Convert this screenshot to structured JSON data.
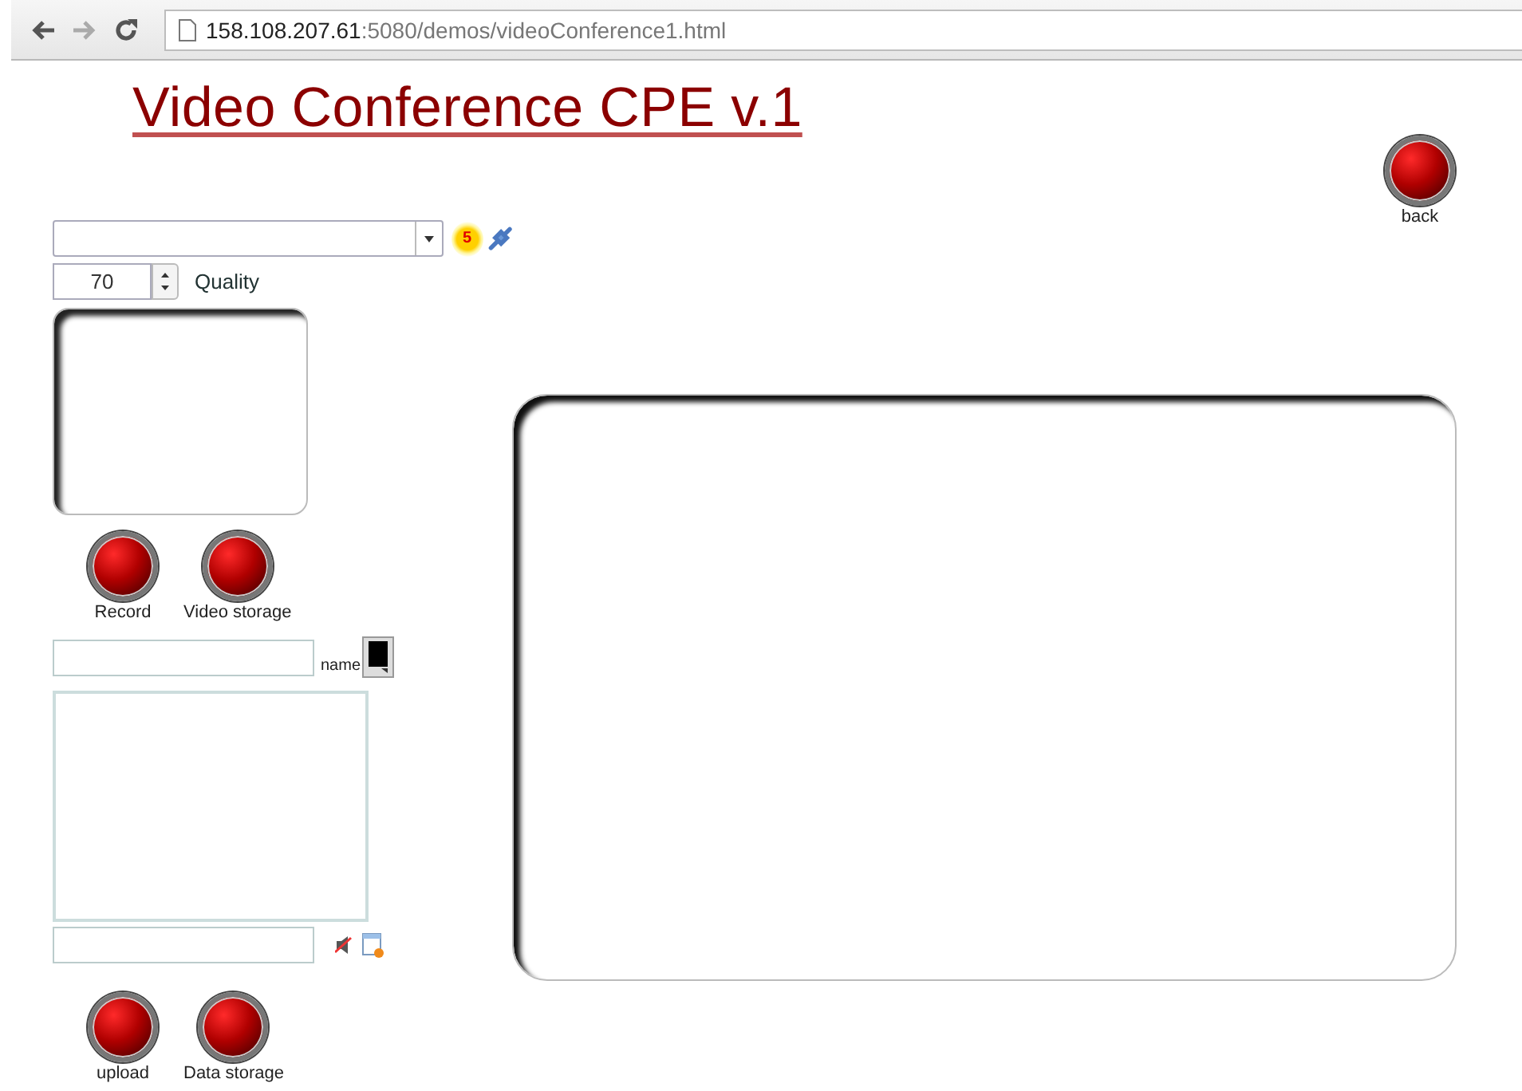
{
  "address_bar": {
    "host": "158.108.207.61",
    "rest": ":5080/demos/videoConference1.html"
  },
  "title": "Video Conference CPE v.1",
  "back_button": {
    "label": "back"
  },
  "device_row": {
    "badge": "5"
  },
  "quality": {
    "value": "70",
    "label": "Quality"
  },
  "video_buttons": [
    {
      "label": "Record"
    },
    {
      "label": "Video storage"
    }
  ],
  "name_row": {
    "label": "name"
  },
  "data_buttons": [
    {
      "label": "upload"
    },
    {
      "label": "Data storage"
    }
  ]
}
